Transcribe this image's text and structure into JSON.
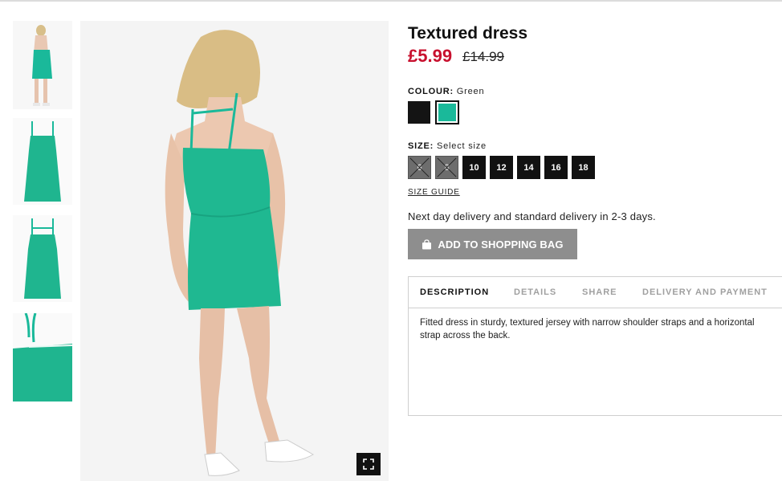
{
  "product": {
    "title": "Textured dress",
    "price": "£5.99",
    "old_price": "£14.99"
  },
  "colour": {
    "label": "COLOUR:",
    "selected": "Green",
    "swatches": [
      {
        "name": "Black",
        "hex": "#141414"
      },
      {
        "name": "Green",
        "hex": "#1ab99a"
      }
    ]
  },
  "size": {
    "label": "SIZE:",
    "prompt": "Select size",
    "options": [
      {
        "label": "6",
        "available": false
      },
      {
        "label": "8",
        "available": false
      },
      {
        "label": "10",
        "available": true
      },
      {
        "label": "12",
        "available": true
      },
      {
        "label": "14",
        "available": true
      },
      {
        "label": "16",
        "available": true
      },
      {
        "label": "18",
        "available": true
      }
    ],
    "guide_link": "SIZE GUIDE"
  },
  "delivery_text": "Next day delivery and standard delivery in 2-3 days.",
  "add_to_bag": {
    "label": "ADD TO SHOPPING BAG",
    "icon": "shopping-bag-icon"
  },
  "tabs": [
    {
      "label": "DESCRIPTION",
      "active": true
    },
    {
      "label": "DETAILS",
      "active": false
    },
    {
      "label": "SHARE",
      "active": false
    },
    {
      "label": "DELIVERY AND PAYMENT",
      "active": false
    }
  ],
  "description": "Fitted dress in sturdy, textured jersey with narrow shoulder straps and a horizontal strap across the back.",
  "colors": {
    "price_red": "#c8102e",
    "dress_green": "#1ab99a",
    "button_grey": "#8e8e8e"
  }
}
